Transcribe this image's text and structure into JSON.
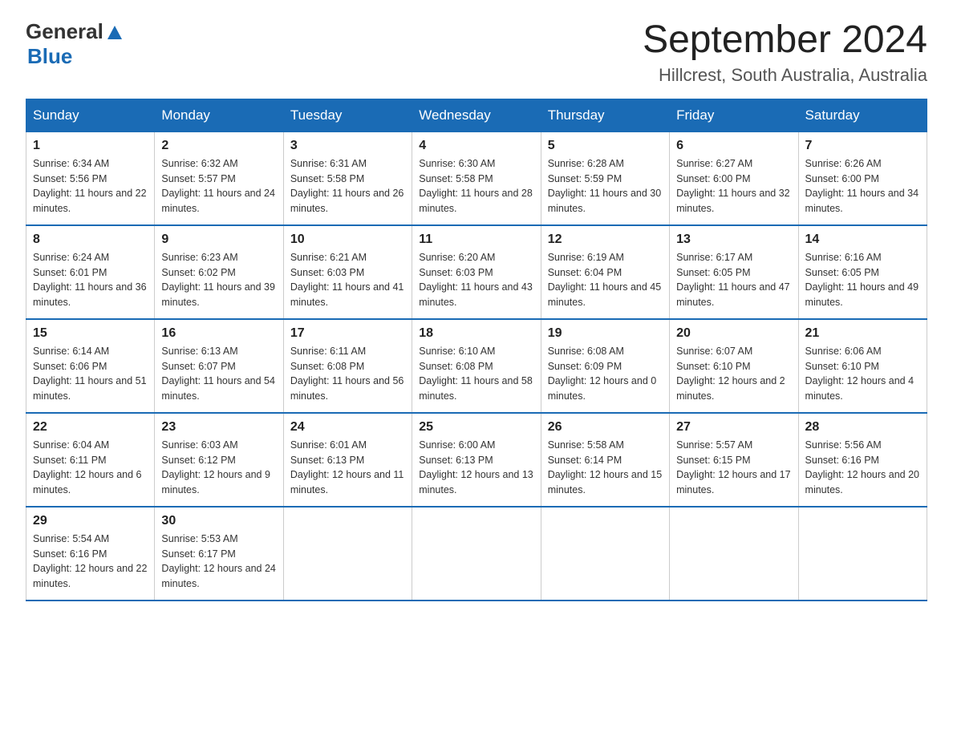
{
  "header": {
    "logo": {
      "text_general": "General",
      "text_blue": "Blue",
      "alt": "GeneralBlue Logo"
    },
    "title": "September 2024",
    "subtitle": "Hillcrest, South Australia, Australia"
  },
  "weekdays": [
    "Sunday",
    "Monday",
    "Tuesday",
    "Wednesday",
    "Thursday",
    "Friday",
    "Saturday"
  ],
  "weeks": [
    [
      {
        "day": "1",
        "sunrise": "Sunrise: 6:34 AM",
        "sunset": "Sunset: 5:56 PM",
        "daylight": "Daylight: 11 hours and 22 minutes."
      },
      {
        "day": "2",
        "sunrise": "Sunrise: 6:32 AM",
        "sunset": "Sunset: 5:57 PM",
        "daylight": "Daylight: 11 hours and 24 minutes."
      },
      {
        "day": "3",
        "sunrise": "Sunrise: 6:31 AM",
        "sunset": "Sunset: 5:58 PM",
        "daylight": "Daylight: 11 hours and 26 minutes."
      },
      {
        "day": "4",
        "sunrise": "Sunrise: 6:30 AM",
        "sunset": "Sunset: 5:58 PM",
        "daylight": "Daylight: 11 hours and 28 minutes."
      },
      {
        "day": "5",
        "sunrise": "Sunrise: 6:28 AM",
        "sunset": "Sunset: 5:59 PM",
        "daylight": "Daylight: 11 hours and 30 minutes."
      },
      {
        "day": "6",
        "sunrise": "Sunrise: 6:27 AM",
        "sunset": "Sunset: 6:00 PM",
        "daylight": "Daylight: 11 hours and 32 minutes."
      },
      {
        "day": "7",
        "sunrise": "Sunrise: 6:26 AM",
        "sunset": "Sunset: 6:00 PM",
        "daylight": "Daylight: 11 hours and 34 minutes."
      }
    ],
    [
      {
        "day": "8",
        "sunrise": "Sunrise: 6:24 AM",
        "sunset": "Sunset: 6:01 PM",
        "daylight": "Daylight: 11 hours and 36 minutes."
      },
      {
        "day": "9",
        "sunrise": "Sunrise: 6:23 AM",
        "sunset": "Sunset: 6:02 PM",
        "daylight": "Daylight: 11 hours and 39 minutes."
      },
      {
        "day": "10",
        "sunrise": "Sunrise: 6:21 AM",
        "sunset": "Sunset: 6:03 PM",
        "daylight": "Daylight: 11 hours and 41 minutes."
      },
      {
        "day": "11",
        "sunrise": "Sunrise: 6:20 AM",
        "sunset": "Sunset: 6:03 PM",
        "daylight": "Daylight: 11 hours and 43 minutes."
      },
      {
        "day": "12",
        "sunrise": "Sunrise: 6:19 AM",
        "sunset": "Sunset: 6:04 PM",
        "daylight": "Daylight: 11 hours and 45 minutes."
      },
      {
        "day": "13",
        "sunrise": "Sunrise: 6:17 AM",
        "sunset": "Sunset: 6:05 PM",
        "daylight": "Daylight: 11 hours and 47 minutes."
      },
      {
        "day": "14",
        "sunrise": "Sunrise: 6:16 AM",
        "sunset": "Sunset: 6:05 PM",
        "daylight": "Daylight: 11 hours and 49 minutes."
      }
    ],
    [
      {
        "day": "15",
        "sunrise": "Sunrise: 6:14 AM",
        "sunset": "Sunset: 6:06 PM",
        "daylight": "Daylight: 11 hours and 51 minutes."
      },
      {
        "day": "16",
        "sunrise": "Sunrise: 6:13 AM",
        "sunset": "Sunset: 6:07 PM",
        "daylight": "Daylight: 11 hours and 54 minutes."
      },
      {
        "day": "17",
        "sunrise": "Sunrise: 6:11 AM",
        "sunset": "Sunset: 6:08 PM",
        "daylight": "Daylight: 11 hours and 56 minutes."
      },
      {
        "day": "18",
        "sunrise": "Sunrise: 6:10 AM",
        "sunset": "Sunset: 6:08 PM",
        "daylight": "Daylight: 11 hours and 58 minutes."
      },
      {
        "day": "19",
        "sunrise": "Sunrise: 6:08 AM",
        "sunset": "Sunset: 6:09 PM",
        "daylight": "Daylight: 12 hours and 0 minutes."
      },
      {
        "day": "20",
        "sunrise": "Sunrise: 6:07 AM",
        "sunset": "Sunset: 6:10 PM",
        "daylight": "Daylight: 12 hours and 2 minutes."
      },
      {
        "day": "21",
        "sunrise": "Sunrise: 6:06 AM",
        "sunset": "Sunset: 6:10 PM",
        "daylight": "Daylight: 12 hours and 4 minutes."
      }
    ],
    [
      {
        "day": "22",
        "sunrise": "Sunrise: 6:04 AM",
        "sunset": "Sunset: 6:11 PM",
        "daylight": "Daylight: 12 hours and 6 minutes."
      },
      {
        "day": "23",
        "sunrise": "Sunrise: 6:03 AM",
        "sunset": "Sunset: 6:12 PM",
        "daylight": "Daylight: 12 hours and 9 minutes."
      },
      {
        "day": "24",
        "sunrise": "Sunrise: 6:01 AM",
        "sunset": "Sunset: 6:13 PM",
        "daylight": "Daylight: 12 hours and 11 minutes."
      },
      {
        "day": "25",
        "sunrise": "Sunrise: 6:00 AM",
        "sunset": "Sunset: 6:13 PM",
        "daylight": "Daylight: 12 hours and 13 minutes."
      },
      {
        "day": "26",
        "sunrise": "Sunrise: 5:58 AM",
        "sunset": "Sunset: 6:14 PM",
        "daylight": "Daylight: 12 hours and 15 minutes."
      },
      {
        "day": "27",
        "sunrise": "Sunrise: 5:57 AM",
        "sunset": "Sunset: 6:15 PM",
        "daylight": "Daylight: 12 hours and 17 minutes."
      },
      {
        "day": "28",
        "sunrise": "Sunrise: 5:56 AM",
        "sunset": "Sunset: 6:16 PM",
        "daylight": "Daylight: 12 hours and 20 minutes."
      }
    ],
    [
      {
        "day": "29",
        "sunrise": "Sunrise: 5:54 AM",
        "sunset": "Sunset: 6:16 PM",
        "daylight": "Daylight: 12 hours and 22 minutes."
      },
      {
        "day": "30",
        "sunrise": "Sunrise: 5:53 AM",
        "sunset": "Sunset: 6:17 PM",
        "daylight": "Daylight: 12 hours and 24 minutes."
      },
      null,
      null,
      null,
      null,
      null
    ]
  ]
}
